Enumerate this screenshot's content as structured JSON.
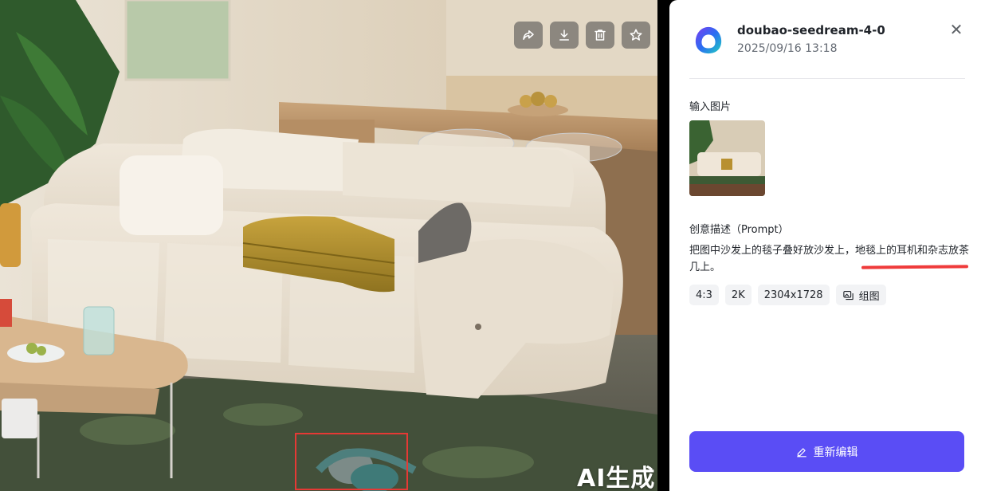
{
  "viewer": {
    "watermark": "AI生成",
    "toolbar": {
      "share_icon": "share-icon",
      "download_icon": "download-icon",
      "delete_icon": "trash-icon",
      "favorite_icon": "star-icon"
    },
    "highlight_color": "#e53935"
  },
  "panel": {
    "model_name": "doubao-seedream-4-0",
    "timestamp": "2025/09/16 13:18",
    "close_symbol": "✕",
    "input_label": "输入图片",
    "prompt_label": "创意描述（Prompt）",
    "prompt_text": "把图中沙发上的毯子叠好放沙发上，地毯上的耳机和杂志放茶几上。",
    "tags": [
      {
        "label": "4:3"
      },
      {
        "label": "2K"
      },
      {
        "label": "2304x1728"
      },
      {
        "label": "组图",
        "icon": "image-group-icon"
      }
    ],
    "edit_button_label": "重新编辑",
    "accent_color": "#5a4df5"
  }
}
